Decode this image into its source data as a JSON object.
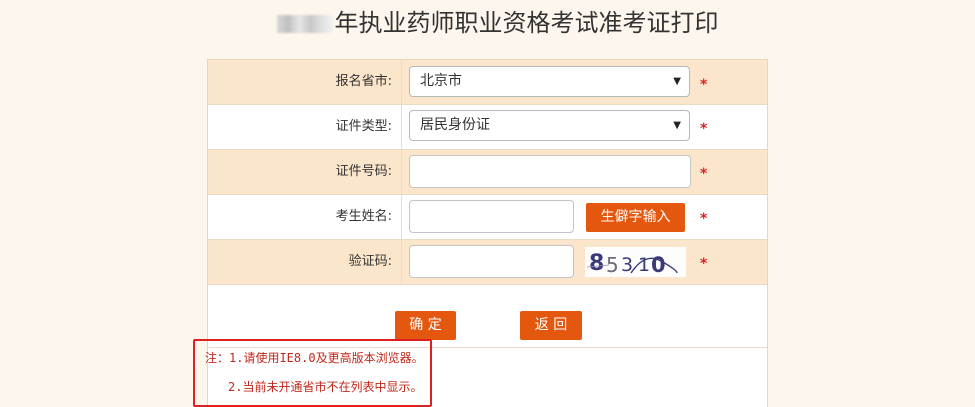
{
  "page": {
    "title_blurred_prefix": "",
    "title": "年执业药师职业资格考试准考证打印"
  },
  "form": {
    "province": {
      "label": "报名省市:",
      "value": "北京市"
    },
    "id_type": {
      "label": "证件类型:",
      "value": "居民身份证"
    },
    "id_number": {
      "label": "证件号码:",
      "value": "",
      "placeholder": ""
    },
    "name": {
      "label": "考生姓名:",
      "value": "",
      "placeholder": "",
      "rare_char_button": "生僻字输入"
    },
    "captcha": {
      "label": "验证码:",
      "value": "",
      "placeholder": "",
      "image_text": "85310"
    },
    "required_mark": "*"
  },
  "actions": {
    "confirm": "确 定",
    "back": "返 回"
  },
  "notice": {
    "line1": "注：1.请使用IE8.0及更高版本浏览器。",
    "line2": "2.当前未开通省市不在列表中显示。"
  },
  "colors": {
    "page_bg": "#fdf6ec",
    "row_shade": "#fbe6cc",
    "accent_orange": "#e4570f",
    "required_red": "#e02020",
    "notice_red": "#c0281b"
  },
  "icons": {
    "select_arrow": "chevron-down-icon"
  }
}
